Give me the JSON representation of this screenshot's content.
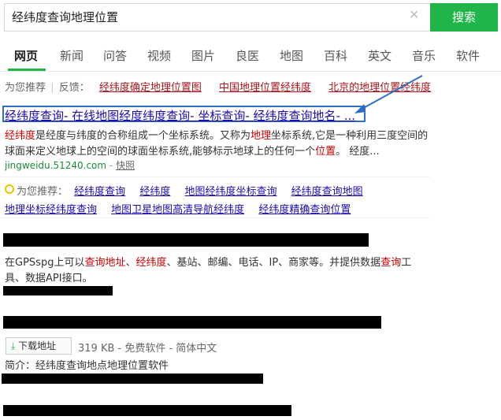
{
  "search": {
    "query": "经纬度查询地理位置",
    "button_label": "搜索",
    "clear_icon": "close-icon"
  },
  "tabs": [
    "网页",
    "新闻",
    "问答",
    "视频",
    "图片",
    "良医",
    "地图",
    "百科",
    "英文",
    "音乐",
    "软件"
  ],
  "recommend_bar": {
    "label": "为您推荐",
    "separator": "|",
    "feedback": "反馈：",
    "links": [
      "经纬度确定地理位置图",
      "中国地理位置经纬度",
      "北京的地理位置经纬度"
    ]
  },
  "result1": {
    "title": "经纬度查询- 在线地图经度纬度查询- 坐标查询- 经纬度查询地名- ...",
    "snippet_line1_parts": [
      "经纬度",
      "是经度与纬度的合称组成一个坐标系统。又称为",
      "地理",
      "坐标系统,它是一种利用三度空间的"
    ],
    "snippet_line2_parts": [
      "球面来定义地球上的空间的球面坐标系统,能够标示地球上的任何一个",
      "位置",
      "。 经度..."
    ],
    "url": "jingweidu.51240.com",
    "snapshot": "快照"
  },
  "recommend_block": {
    "label": "为您推荐：",
    "row1": [
      "经纬度查询",
      "经纬度",
      "地图经纬度坐标查询",
      "经纬度查询地图"
    ],
    "row2": [
      "地理坐标经纬度查询",
      "地图卫星地图高清导航经纬度",
      "经纬度精确查询位置"
    ]
  },
  "result2": {
    "snippet_line1_parts": [
      "在GPSspg上可以",
      "查询地址",
      "、",
      "经纬度",
      "、基站、邮编、电话、IP、商家等。并提供数据",
      "查询",
      "工"
    ],
    "snippet_line2": "具、数据API接口。"
  },
  "result3": {
    "download_label": "下载地址",
    "meta": "319 KB - 免费软件 - 简体中文",
    "intro": "简介：经纬度查询地点地理位置软件"
  },
  "colors": {
    "accent": "#1fb548",
    "link": "#1a0dab",
    "red": "#a8151b",
    "highlight_box": "#2e6ec7"
  }
}
